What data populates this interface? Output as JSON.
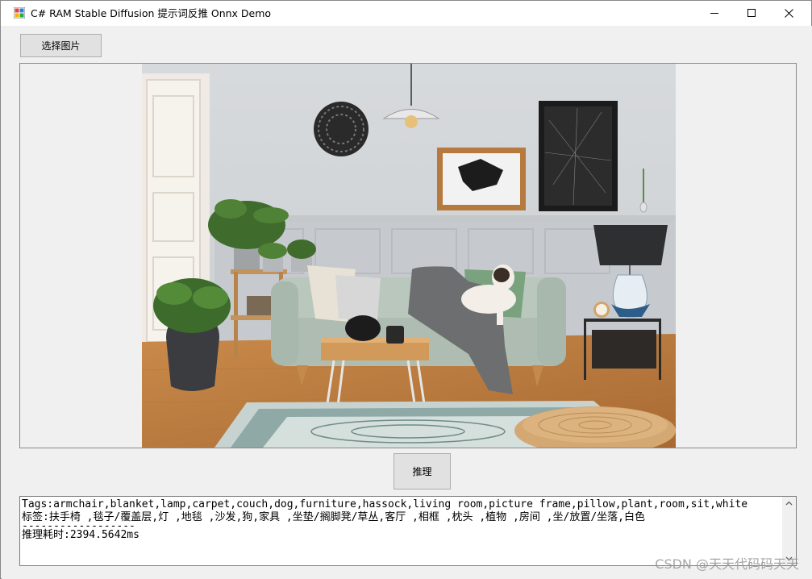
{
  "window": {
    "title": "C# RAM Stable Diffusion 提示词反推 Onnx Demo",
    "controls": {
      "minimize": "minimize",
      "maximize": "maximize",
      "close": "close"
    }
  },
  "toolbar": {
    "select_image_label": "选择图片",
    "infer_label": "推理"
  },
  "output": {
    "tags_line": "Tags:armchair,blanket,lamp,carpet,couch,dog,furniture,hassock,living room,picture frame,pillow,plant,room,sit,white",
    "labels_line": "标签:扶手椅 ,毯子/覆盖层,灯 ,地毯 ,沙发,狗,家具 ,坐垫/搁脚凳/草丛,客厅 ,相框 ,枕头 ,植物 ,房间 ,坐/放置/坐落,白色",
    "separator": "------------------",
    "time_line": "推理耗时:2394.5642ms"
  },
  "watermark": "CSDN @天天代码码天天",
  "icons": [
    "app-icon",
    "minimize-icon",
    "maximize-icon",
    "close-icon",
    "scroll-up-icon",
    "scroll-down-icon"
  ],
  "colors": {
    "window_bg": "#f0f0f0",
    "button_bg": "#e1e1e1",
    "border": "#adadad"
  }
}
